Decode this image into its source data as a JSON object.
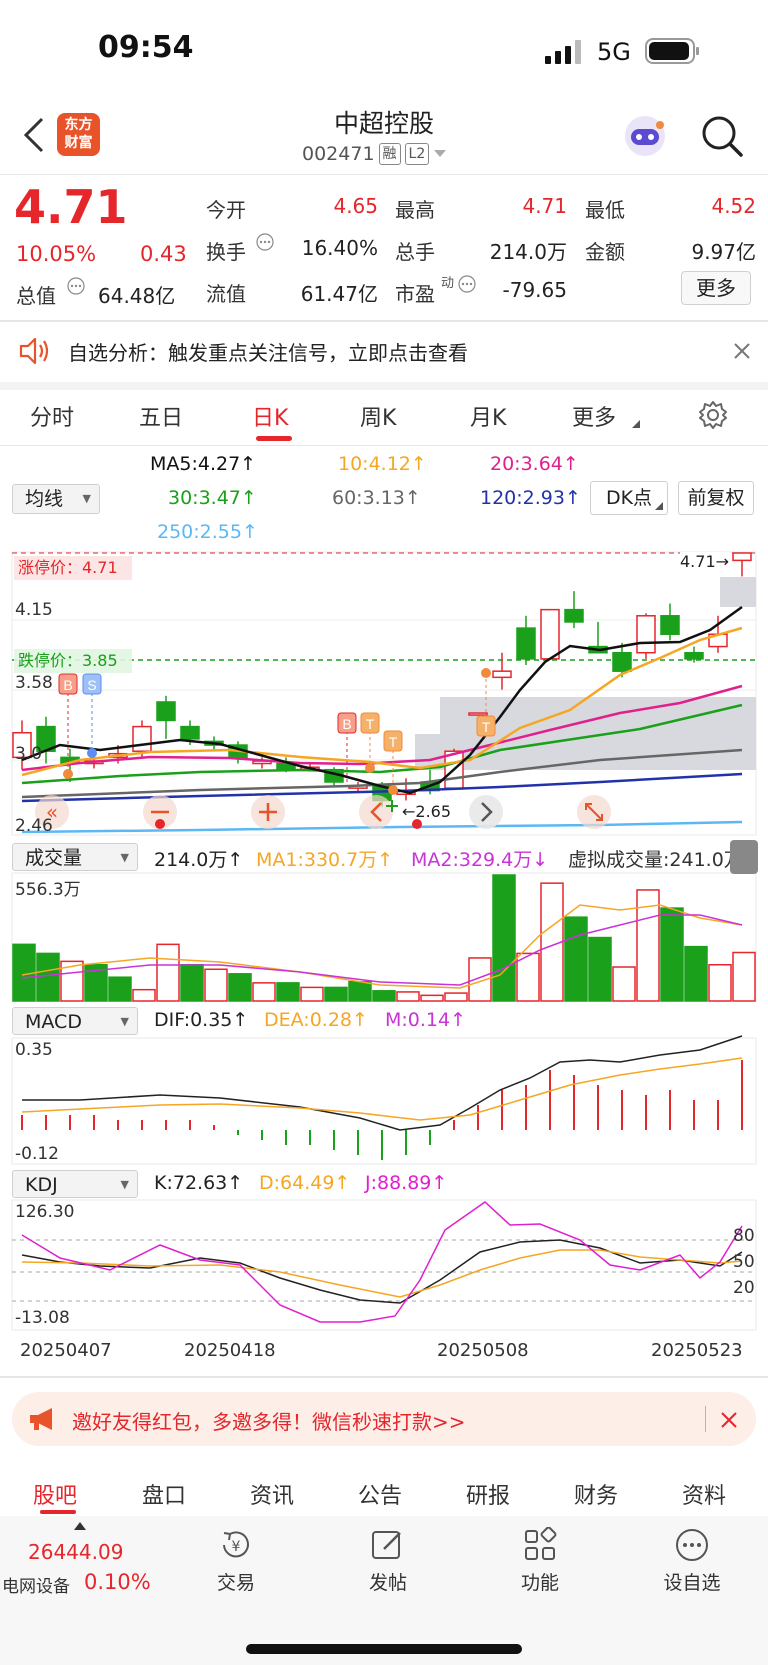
{
  "status": {
    "time": "09:54",
    "network": "5G"
  },
  "header": {
    "title": "中超控股",
    "code": "002471",
    "tags": [
      "融",
      "L2"
    ],
    "logo_text": "东方财富"
  },
  "quote": {
    "price": "4.71",
    "change_pct": "10.05%",
    "change_amt": "0.43",
    "open_label": "今开",
    "open": "4.65",
    "high_label": "最高",
    "high": "4.71",
    "low_label": "最低",
    "low": "4.52",
    "turnover_label": "换手",
    "turnover": "16.40%",
    "volume_label": "总手",
    "volume": "214.0万",
    "amount_label": "金额",
    "amount": "9.97亿",
    "mktcap_label": "总值",
    "mktcap": "64.48亿",
    "float_label": "流值",
    "float_cap": "61.47亿",
    "pe_label": "市盈",
    "pe_sup": "动",
    "pe": "-79.65",
    "more_button": "更多"
  },
  "alert": {
    "text": "自选分析：触发重点关注信号，立即点击查看"
  },
  "period_tabs": [
    "分时",
    "五日",
    "日K",
    "周K",
    "月K",
    "更多"
  ],
  "active_period": "日K",
  "ma": {
    "selector": "均线",
    "ma5": "MA5:4.27↑",
    "ma10": "10:4.12↑",
    "ma20": "20:3.64↑",
    "ma30": "30:3.47↑",
    "ma60": "60:3.13↑",
    "ma120": "120:2.93↑",
    "ma250": "250:2.55↑",
    "dk_button": "DK点",
    "adjust_button": "前复权",
    "colors": {
      "ma5": "#111111",
      "ma10": "#f5a623",
      "ma20": "#e0208c",
      "ma30": "#1aa01a",
      "ma60": "#666666",
      "ma120": "#2233aa",
      "ma250": "#5bb8f5"
    }
  },
  "kline": {
    "limit_up_label": "涨停价：4.71",
    "limit_down_label": "跌停价：3.85",
    "y_labels": [
      "4.71",
      "4.15",
      "3.58",
      "3.0",
      "2.46"
    ],
    "high_tag": "4.71→",
    "low_tag": "←2.65"
  },
  "volume": {
    "selector": "成交量",
    "vol": "214.0万↑",
    "ma1": "MA1:330.7万↑",
    "ma2": "MA2:329.4万↓",
    "virtual": "虚拟成交量:241.0万",
    "max_label": "556.3万"
  },
  "macd": {
    "selector": "MACD",
    "dif": "DIF:0.35↑",
    "dea": "DEA:0.28↑",
    "m": "M:0.14↑",
    "top_label": "0.35",
    "bottom_label": "-0.12"
  },
  "kdj": {
    "selector": "KDJ",
    "k": "K:72.63↑",
    "d": "D:64.49↑",
    "j": "J:88.89↑",
    "top_label": "126.30",
    "bottom_label": "-13.08",
    "levels": [
      "80",
      "50",
      "20"
    ]
  },
  "dates": [
    "20250407",
    "20250418",
    "20250508",
    "20250523"
  ],
  "promo": {
    "text": "邀好友得红包，多邀多得！微信秒速打款>>"
  },
  "bottom_tabs": [
    "股吧",
    "盘口",
    "资讯",
    "公告",
    "研报",
    "财务",
    "资料"
  ],
  "footer": {
    "index_value": "26444.09",
    "index_name": "电网设备",
    "index_change": "0.10%",
    "items": [
      "交易",
      "发帖",
      "功能",
      "设自选"
    ]
  },
  "chart_data": {
    "type": "candlestick",
    "candles": [
      {
        "o": 3.05,
        "c": 3.25,
        "h": 3.35,
        "l": 2.95
      },
      {
        "o": 3.3,
        "c": 3.1,
        "h": 3.38,
        "l": 3.0
      },
      {
        "o": 3.05,
        "c": 3.0,
        "h": 3.12,
        "l": 2.85
      },
      {
        "o": 3.0,
        "c": 3.02,
        "h": 3.1,
        "l": 2.96
      },
      {
        "o": 3.05,
        "c": 3.08,
        "h": 3.15,
        "l": 3.0
      },
      {
        "o": 3.1,
        "c": 3.3,
        "h": 3.35,
        "l": 3.05
      },
      {
        "o": 3.5,
        "c": 3.35,
        "h": 3.55,
        "l": 3.2
      },
      {
        "o": 3.3,
        "c": 3.2,
        "h": 3.35,
        "l": 3.15
      },
      {
        "o": 3.18,
        "c": 3.15,
        "h": 3.22,
        "l": 3.1
      },
      {
        "o": 3.15,
        "c": 3.05,
        "h": 3.18,
        "l": 3.0
      },
      {
        "o": 3.0,
        "c": 3.02,
        "h": 3.05,
        "l": 2.96
      },
      {
        "o": 3.0,
        "c": 2.95,
        "h": 3.05,
        "l": 2.93
      },
      {
        "o": 2.96,
        "c": 2.97,
        "h": 3.0,
        "l": 2.94
      },
      {
        "o": 2.95,
        "c": 2.85,
        "h": 2.97,
        "l": 2.82
      },
      {
        "o": 2.8,
        "c": 2.82,
        "h": 2.85,
        "l": 2.76
      },
      {
        "o": 2.82,
        "c": 2.7,
        "h": 2.85,
        "l": 2.65
      },
      {
        "o": 2.75,
        "c": 2.78,
        "h": 2.88,
        "l": 2.7
      },
      {
        "o": 2.85,
        "c": 2.78,
        "h": 2.95,
        "l": 2.75
      },
      {
        "o": 2.8,
        "c": 3.1,
        "h": 3.12,
        "l": 2.8
      },
      {
        "o": 3.41,
        "c": 3.41,
        "h": 3.41,
        "l": 3.41
      },
      {
        "o": 3.7,
        "c": 3.75,
        "h": 3.9,
        "l": 3.6
      },
      {
        "o": 4.1,
        "c": 3.85,
        "h": 4.2,
        "l": 3.8
      },
      {
        "o": 3.85,
        "c": 4.25,
        "h": 4.25,
        "l": 3.85
      },
      {
        "o": 4.25,
        "c": 4.15,
        "h": 4.4,
        "l": 4.1
      },
      {
        "o": 3.95,
        "c": 3.9,
        "h": 4.15,
        "l": 3.9
      },
      {
        "o": 3.9,
        "c": 3.75,
        "h": 3.98,
        "l": 3.7
      },
      {
        "o": 3.9,
        "c": 4.2,
        "h": 4.22,
        "l": 3.85
      },
      {
        "o": 4.2,
        "c": 4.05,
        "h": 4.3,
        "l": 4.0
      },
      {
        "o": 3.9,
        "c": 3.85,
        "h": 3.95,
        "l": 3.82
      },
      {
        "o": 3.95,
        "c": 4.05,
        "h": 4.2,
        "l": 3.9
      },
      {
        "o": 4.65,
        "c": 4.71,
        "h": 4.71,
        "l": 4.52
      }
    ],
    "volume_series": [
      {
        "v": 250,
        "up": false
      },
      {
        "v": 210,
        "up": false
      },
      {
        "v": 175,
        "up": true
      },
      {
        "v": 160,
        "up": false
      },
      {
        "v": 105,
        "up": false
      },
      {
        "v": 50,
        "up": true
      },
      {
        "v": 250,
        "up": true
      },
      {
        "v": 160,
        "up": false
      },
      {
        "v": 140,
        "up": true
      },
      {
        "v": 120,
        "up": false
      },
      {
        "v": 80,
        "up": true
      },
      {
        "v": 80,
        "up": false
      },
      {
        "v": 60,
        "up": true
      },
      {
        "v": 60,
        "up": false
      },
      {
        "v": 85,
        "up": false
      },
      {
        "v": 45,
        "up": false
      },
      {
        "v": 40,
        "up": true
      },
      {
        "v": 25,
        "up": true
      },
      {
        "v": 35,
        "up": true
      },
      {
        "v": 190,
        "up": true
      },
      {
        "v": 556,
        "up": false
      },
      {
        "v": 210,
        "up": true
      },
      {
        "v": 520,
        "up": true
      },
      {
        "v": 370,
        "up": false
      },
      {
        "v": 280,
        "up": false
      },
      {
        "v": 150,
        "up": true
      },
      {
        "v": 490,
        "up": true
      },
      {
        "v": 410,
        "up": false
      },
      {
        "v": 240,
        "up": false
      },
      {
        "v": 160,
        "up": true
      },
      {
        "v": 214,
        "up": true
      }
    ],
    "macd_bars": [
      0.03,
      0.03,
      0.03,
      0.03,
      0.02,
      0.02,
      0.02,
      0.02,
      0.01,
      -0.01,
      -0.02,
      -0.03,
      -0.03,
      -0.04,
      -0.05,
      -0.06,
      -0.05,
      -0.03,
      0.02,
      0.05,
      0.08,
      0.09,
      0.12,
      0.11,
      0.09,
      0.08,
      0.07,
      0.08,
      0.06,
      0.06,
      0.14
    ],
    "xlim_dates": [
      "20250407",
      "20250523"
    ]
  }
}
